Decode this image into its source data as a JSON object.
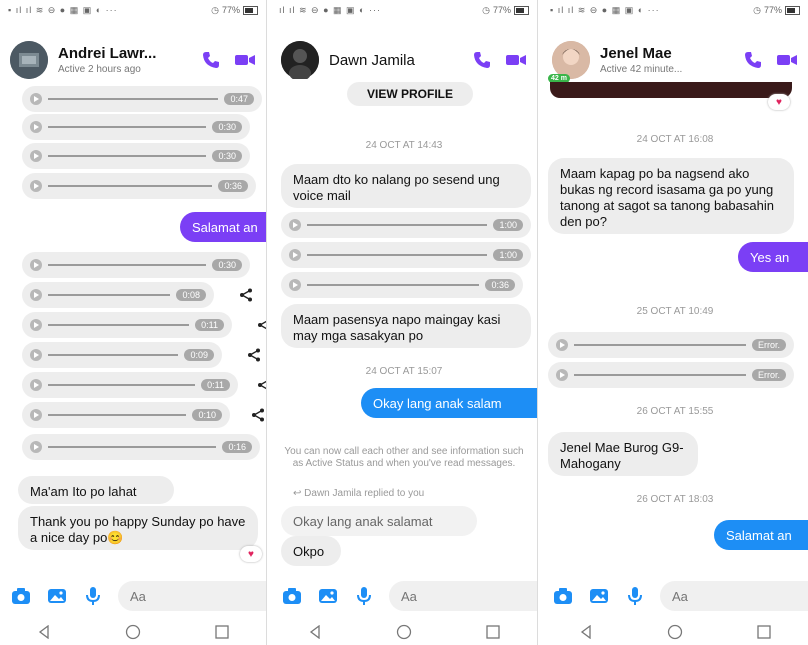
{
  "accent": "#7b3ff5",
  "accent_blue": "#1d8ef5",
  "status_bar": {
    "battery": "77%"
  },
  "composer": {
    "placeholder": "Aa"
  },
  "panels": [
    {
      "header": {
        "name": "Andrei Lawr...",
        "sub": "Active 2 hours ago"
      },
      "audio_group1": [
        "0:47",
        "0:30",
        "0:30",
        "0:36"
      ],
      "outgoing": "Salamat an",
      "audio_group2": [
        "0:30",
        "0:08",
        "0:11",
        "0:09",
        "0:11",
        "0:10",
        "0:16"
      ],
      "msg1": "Ma'am Ito po lahat",
      "msg2": "Thank you po happy Sunday po have a nice day po😊"
    },
    {
      "header": {
        "name": "Dawn Jamila"
      },
      "view_profile": "VIEW PROFILE",
      "stamp1": "24 OCT AT 14:43",
      "msg1": "Maam dto ko nalang po sesend ung voice mail",
      "audio": [
        "1:00",
        "1:00",
        "0:36"
      ],
      "msg2": "Maam pasensya napo maingay kasi may mga sasakyan po",
      "stamp2": "24 OCT AT 15:07",
      "outgoing": "Okay lang anak salam",
      "note": "You can now call each other and see information such as Active Status and when you've read messages.",
      "replied": "Dawn Jamila replied to you",
      "quoted": "Okay lang anak salamat",
      "msg3": "Okpo"
    },
    {
      "header": {
        "name": "Jenel Mae",
        "sub": "Active 42 minute...",
        "badge": "42 m"
      },
      "stamp1": "24 OCT AT 16:08",
      "msg1": "Maam kapag po ba nagsend ako bukas ng record isasama ga po yung tanong at sagot sa tanong babasahin den po?",
      "outgoing1": "Yes an",
      "stamp2": "25 OCT AT 10:49",
      "audio": [
        "Error.",
        "Error."
      ],
      "stamp3": "26 OCT AT 15:55",
      "msg2": "Jenel Mae Burog G9-Mahogany",
      "stamp4": "26 OCT AT 18:03",
      "outgoing2": "Salamat an"
    }
  ]
}
